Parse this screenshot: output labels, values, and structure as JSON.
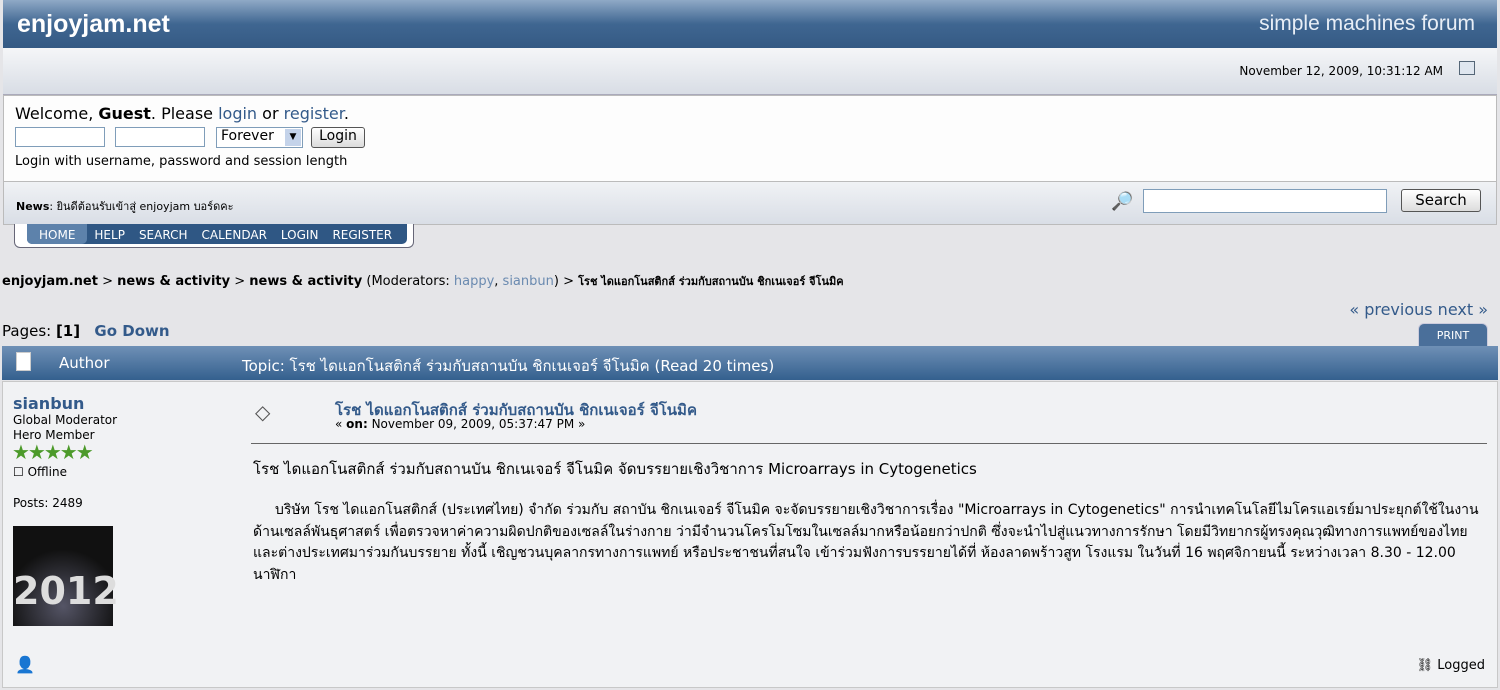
{
  "header": {
    "title": "enjoyjam.net",
    "brand": "simple machines forum"
  },
  "date": "November 12, 2009, 10:31:12 AM",
  "welcome": {
    "prefix": "Welcome, ",
    "guest": "Guest",
    "mid": ". Please ",
    "login": "login",
    "or": " or ",
    "register": "register",
    "end": ".",
    "session_option": "Forever",
    "login_button": "Login",
    "hint": "Login with username, password and session length"
  },
  "news": {
    "label": "News",
    "text": ": ยินดีต้อนรับเข้าสู่ enjoyjam บอร์ดคะ",
    "search_button": "Search",
    "search_value": ""
  },
  "menu": [
    "HOME",
    "HELP",
    "SEARCH",
    "CALENDAR",
    "LOGIN",
    "REGISTER"
  ],
  "breadcrumb": {
    "site": "enjoyjam.net",
    "board1": "news & activity",
    "board2": "news & activity",
    "mods_prefix": " (Moderators: ",
    "mod1": "happy",
    "mod2": "sianbun",
    "mods_suffix": ")",
    "topic": "โรช ไดแอกโนสติกส์ ร่วมกับสถานบัน ชิกเนเจอร์ จีโนมิค",
    "sep": " > "
  },
  "pages": {
    "label": "Pages: ",
    "current": "[1]",
    "go_down": "Go Down",
    "nav": "« previous next »",
    "print": "PRINT"
  },
  "topic_header": {
    "author": "Author",
    "topic": "Topic: โรช ไดแอกโนสติกส์ ร่วมกับสถานบัน ชิกเนเจอร์ จีโนมิค  (Read 20 times)"
  },
  "post": {
    "author": "sianbun",
    "role": "Global Moderator",
    "rank": "Hero Member",
    "stars": "★★★★★",
    "status": "Offline",
    "posts": "Posts: 2489",
    "avatar_text": "2012",
    "title": "โรช ไดแอกโนสติกส์ ร่วมกับสถานบัน ชิกเนเจอร์ จีโนมิค",
    "on_label": "on:",
    "date": "November 09, 2009, 05:37:47 PM",
    "body1": "โรช ไดแอกโนสติกส์ ร่วมกับสถานบัน ชิกเนเจอร์ จีโนมิค จัดบรรยายเชิงวิชาการ Microarrays in Cytogenetics",
    "body2": "บริษัท โรช ไดแอกโนสติกส์ (ประเทศไทย) จำกัด ร่วมกับ สถาบัน ชิกเนเจอร์ จีโนมิค จะจัดบรรยายเชิงวิชาการเรื่อง \"Microarrays in Cytogenetics\" การนำเทคโนโลยีไมโครแอเรย์มาประยุกต์ใช้ในงานด้านเซลล์พันธุศาสตร์ เพื่อตรวจหาค่าความผิดปกติของเซลล์ในร่างกาย ว่ามีจำนวนโครโมโซมในเซลล์มากหรือน้อยกว่าปกติ ซึ่งจะนำไปสู่แนวทางการรักษา โดยมีวิทยากรผู้ทรงคุณวุฒิทางการแพทย์ของไทยและต่างประเทศมาร่วมกันบรรยาย ทั้งนี้ เชิญชวนบุคลากรทางการแพทย์ หรือประชาชนที่สนใจ เข้าร่วมฟังการบรรยายได้ที่  ห้องลาดพร้าวสูท โรงแรม  ในวันที่ 16 พฤศจิกายนนี้  ระหว่างเวลา 8.30 - 12.00 นาฬิกา",
    "logged": "Logged"
  }
}
